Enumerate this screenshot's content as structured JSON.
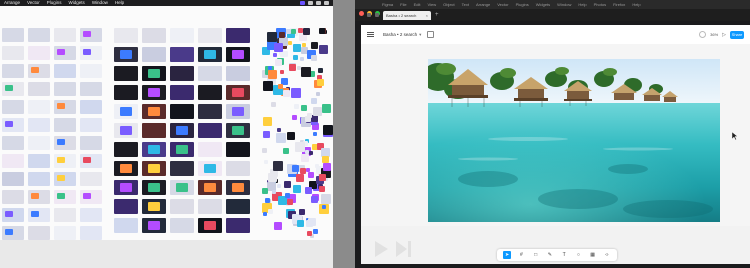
{
  "left_window": {
    "menubar": {
      "items": [
        "Arrange",
        "Vector",
        "Plugins",
        "Widgets",
        "Window",
        "Help"
      ]
    }
  },
  "right_window": {
    "title_strip": {
      "items": [
        "Figma",
        "File",
        "Edit",
        "View",
        "Object",
        "Text",
        "Arrange",
        "Vector",
        "Plugins",
        "Widgets",
        "Window",
        "Help",
        "Photos",
        "Firefox",
        "Help"
      ]
    },
    "tab": {
      "label": "Basha • 2 search"
    },
    "toolbar": {
      "doc_title": "Basha • 2 search",
      "zoom": "36%",
      "share_label": "Share"
    },
    "canvas": {
      "image_alt": "Overwater bungalows on turquoise lagoon"
    },
    "tools": [
      "move",
      "frame",
      "shape",
      "pen",
      "text",
      "comment",
      "components",
      "code"
    ]
  },
  "colors": {
    "accent": "#0d99ff",
    "figma_purple": "#6a52ff",
    "water": "#2fb9c2",
    "sky": "#dceefa"
  }
}
